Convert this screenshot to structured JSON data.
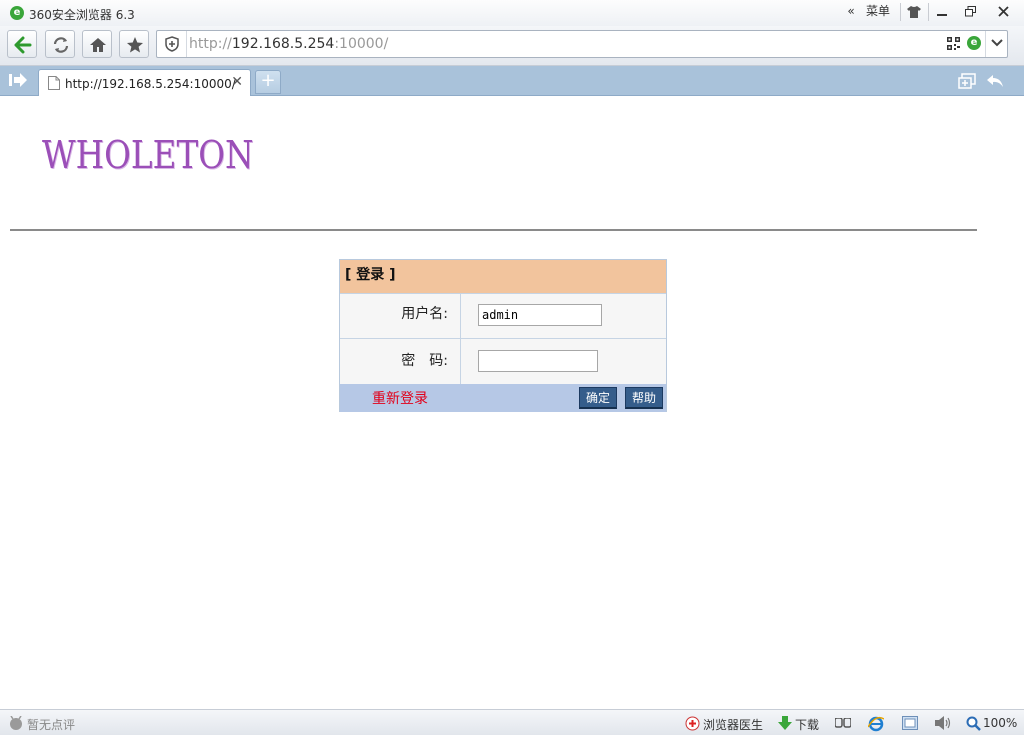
{
  "window": {
    "title": "360安全浏览器 6.3",
    "menu_label": "菜单",
    "menu_chevron": "«"
  },
  "toolbar": {
    "address_scheme": "http://",
    "address_host": "192.168.5.254",
    "address_port": ":10000/"
  },
  "tabs": [
    {
      "label": "http://192.168.5.254:10000/",
      "close": "✕"
    }
  ],
  "tab_new_label": "+",
  "page": {
    "brand": "WHOLETON",
    "login": {
      "header": "[ 登录 ]",
      "username_label": "用户名:",
      "username_value": "admin",
      "password_label": "密　码:",
      "password_value": "",
      "relogin_label": "重新登录",
      "confirm_label": "确定",
      "help_label": "帮助"
    }
  },
  "status": {
    "rating": "暂无点评",
    "doctor": "浏览器医生",
    "download": "下载",
    "zoom": "100%"
  },
  "colors": {
    "brand": "#9b4fb8",
    "login_header": "#f2c49d",
    "login_footer": "#b6c8e6",
    "relogin": "#e2001a",
    "button": "#355d8b",
    "tabbar": "#a9c2da"
  }
}
